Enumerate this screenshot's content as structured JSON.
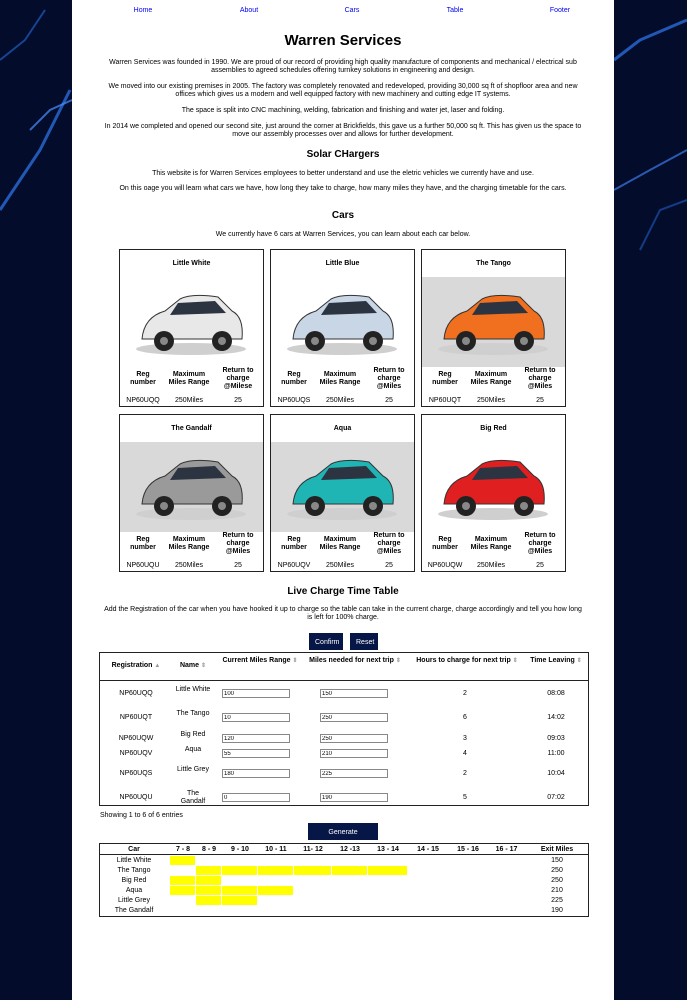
{
  "nav": [
    "Home",
    "About",
    "Cars",
    "Table",
    "Footer"
  ],
  "title": "Warren Services",
  "intro": [
    "Warren Services was founded in 1990. We are proud of our record of providing high quality manufacture of components and mechanical / electrical sub assemblies to agreed schedules offering turnkey solutions in engineering and design.",
    "We moved into our existing premises in 2005. The factory was completely renovated and redeveloped, providing 30,000 sq ft of shopfloor area and new offices which gives us a modern and well equipped factory with new machinery and cutting edge IT systems.",
    "The space is split into CNC machining, welding, fabrication and finishing and water jet, laser and folding.",
    "In 2014 we completed and opened our second site, just around the corner at Brickfields, this gave us a further 50,000 sq ft. This has given us the space to move our assembly processes over and allows for further development."
  ],
  "solar": {
    "heading": "Solar CHargers",
    "p1": "This website is for Warren Services employees to better understand and use the eletric vehicles we currently have and use.",
    "p2": "On this oage you will learn what cars we have, how long they take to charge, how many miles they have, and the charging timetable for the cars."
  },
  "cars_section": {
    "heading": "Cars",
    "intro": "We currently have 6 cars at Warren Services, you can learn about each car below."
  },
  "cars": [
    {
      "name": "Little White",
      "h1": "Reg number",
      "h2": "Maximum Miles Range",
      "h3": "Return to charge @Milese",
      "reg": "NP60UQQ",
      "range": "250Miles",
      "ret": "25",
      "color": "#e8e8e8"
    },
    {
      "name": "Little Blue",
      "h1": "Reg number",
      "h2": "Maximum Miles Range",
      "h3": "Return to charge @Miles",
      "reg": "NP60UQS",
      "range": "250Miles",
      "ret": "25",
      "color": "#c9d6e6"
    },
    {
      "name": "The Tango",
      "h1": "Reg number",
      "h2": "Maximum Miles Range",
      "h3": "Return to charge @Miles",
      "reg": "NP60UQT",
      "range": "250Miles",
      "ret": "25",
      "color": "#f07020"
    },
    {
      "name": "The Gandalf",
      "h1": "Reg number",
      "h2": "Maximum Miles Range",
      "h3": "Return to charge @Miles",
      "reg": "NP60UQU",
      "range": "250Miles",
      "ret": "25",
      "color": "#9a9a9a"
    },
    {
      "name": "Aqua",
      "h1": "Reg number",
      "h2": "Maximum Miles Range",
      "h3": "Return to charge @Miles",
      "reg": "NP60UQV",
      "range": "250Miles",
      "ret": "25",
      "color": "#1fb5b5"
    },
    {
      "name": "Big Red",
      "h1": "Reg number",
      "h2": "Maximum Miles Range",
      "h3": "Return to charge @Miles",
      "reg": "NP60UQW",
      "range": "250Miles",
      "ret": "25",
      "color": "#e02020"
    }
  ],
  "timetable": {
    "heading": "Live Charge Time Table",
    "intro": "Add the Registration of the car when you have hooked it up to charge so the table can take in the current charge, charge accordingly and tell you how long is left for 100% charge.",
    "confirm_label": "Confirm",
    "reset_label": "Reset",
    "headers": [
      "Registration",
      "Name",
      "Current Miles Range",
      "Miles needed for next trip",
      "Hours to charge for next trip",
      "Time Leaving"
    ],
    "rows": [
      {
        "reg": "NP60UQQ",
        "name": "Little White",
        "current": "100",
        "needed": "150",
        "hours": "2",
        "time": "08:08"
      },
      {
        "reg": "NP60UQT",
        "name": "The Tango",
        "current": "10",
        "needed": "250",
        "hours": "6",
        "time": "14:02"
      },
      {
        "reg": "NP60UQW",
        "name": "Big Red",
        "current": "120",
        "needed": "250",
        "hours": "3",
        "time": "09:03"
      },
      {
        "reg": "NP60UQV",
        "name": "Aqua",
        "current": "55",
        "needed": "210",
        "hours": "4",
        "time": "11:00"
      },
      {
        "reg": "NP60UQS",
        "name": "Little Grey",
        "current": "180",
        "needed": "225",
        "hours": "2",
        "time": "10:04"
      },
      {
        "reg": "NP60UQU",
        "name": "The Gandalf",
        "current": "0",
        "needed": "190",
        "hours": "5",
        "time": "07:02"
      }
    ],
    "showing": "Showing 1 to 6 of 6 entries",
    "generate_label": "Generate Schedule"
  },
  "schedule": {
    "headers": [
      "Car",
      "7 - 8",
      "8 - 9",
      "9 - 10",
      "10 - 11",
      "11- 12",
      "12 -13",
      "13 - 14",
      "14 - 15",
      "15 - 16",
      "16 - 17",
      "Exit Miles"
    ],
    "highlight_color": "#ffff00",
    "rows": [
      {
        "car": "Little White",
        "miles": "150",
        "slots": [
          0
        ]
      },
      {
        "car": "The Tango",
        "miles": "250",
        "slots": [
          1,
          2,
          3,
          4,
          5,
          6
        ]
      },
      {
        "car": "Big Red",
        "miles": "250",
        "slots": [
          0,
          1
        ]
      },
      {
        "car": "Aqua",
        "miles": "210",
        "slots": [
          0,
          1,
          2,
          3
        ]
      },
      {
        "car": "Little Grey",
        "miles": "225",
        "slots": [
          1,
          2
        ]
      },
      {
        "car": "The Gandalf",
        "miles": "190",
        "slots": []
      }
    ]
  }
}
